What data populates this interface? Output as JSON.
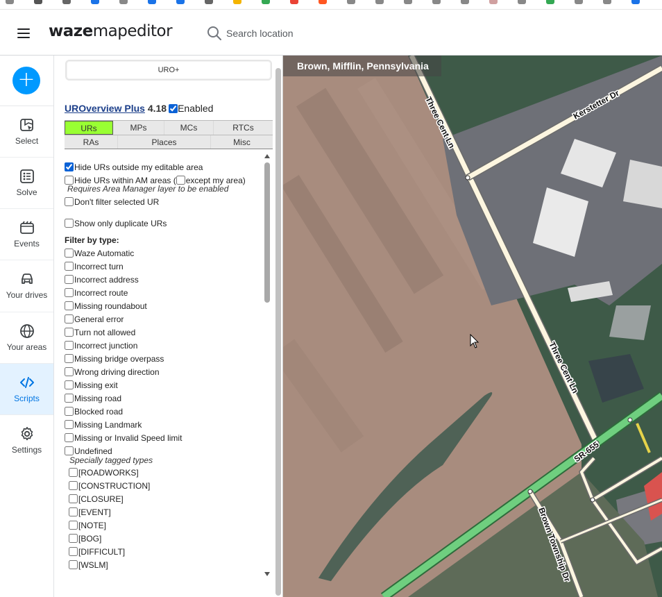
{
  "browser": {
    "bookmark_colors": [
      "#888888",
      "#555555",
      "#666666",
      "#1a73e8",
      "#888888",
      "#1a73e8",
      "#1a73e8",
      "#666666",
      "#f4b400",
      "#34a853",
      "#ea4335",
      "#ff5722",
      "#888888",
      "#888888",
      "#888888",
      "#888888",
      "#888888",
      "#d0a0a0",
      "#888888",
      "#34a853",
      "#888888",
      "#888888",
      "#1a73e8"
    ]
  },
  "header": {
    "logo_part1": "waze",
    "logo_part2": "mapeditor",
    "search_placeholder": "Search location"
  },
  "nav": {
    "items": [
      {
        "label": "Select",
        "icon": "select-icon"
      },
      {
        "label": "Solve",
        "icon": "solve-icon"
      },
      {
        "label": "Events",
        "icon": "events-icon"
      },
      {
        "label": "Your drives",
        "icon": "car-icon"
      },
      {
        "label": "Your areas",
        "icon": "globe-icon"
      },
      {
        "label": "Scripts",
        "icon": "code-icon",
        "active": true
      },
      {
        "label": "Settings",
        "icon": "gear-icon"
      }
    ]
  },
  "panel": {
    "uro_button": "URO+",
    "script_name": "UROverview Plus",
    "script_version": "4.18",
    "enabled_label": "Enabled",
    "enabled": true,
    "tabs_row1": [
      "URs",
      "MPs",
      "MCs",
      "RTCs"
    ],
    "tabs_row2": [
      "RAs",
      "Places",
      "Misc"
    ],
    "active_tab": "URs",
    "options": {
      "hide_outside": {
        "label": "Hide URs outside my editable area",
        "checked": true
      },
      "hide_within_am": {
        "label": "Hide URs within AM areas (",
        "checked": false
      },
      "except_my_area": {
        "label": "except my area)",
        "checked": false
      },
      "am_note": "Requires Area Manager layer to be enabled",
      "dont_filter_selected": {
        "label": "Don't filter selected UR",
        "checked": false
      },
      "show_only_duplicate": {
        "label": "Show only duplicate URs",
        "checked": false
      }
    },
    "filter_by_type_label": "Filter by type:",
    "types": [
      "Waze Automatic",
      "Incorrect turn",
      "Incorrect address",
      "Incorrect route",
      "Missing roundabout",
      "General error",
      "Turn not allowed",
      "Incorrect junction",
      "Missing bridge overpass",
      "Wrong driving direction",
      "Missing exit",
      "Missing road",
      "Blocked road",
      "Missing Landmark",
      "Missing or Invalid Speed limit",
      "Undefined"
    ],
    "specially_tagged_label": "Specially tagged types",
    "tagged_types": [
      "[ROADWORKS]",
      "[CONSTRUCTION]",
      "[CLOSURE]",
      "[EVENT]",
      "[NOTE]",
      "[BOG]",
      "[DIFFICULT]",
      "[WSLM]"
    ]
  },
  "map": {
    "location": "Brown, Mifflin, Pennsylvania",
    "roads": {
      "three_cent_upper": "Three Cent Ln",
      "three_cent_lower": "Three Cent Ln",
      "kerstetter": "Kerstetter Dr",
      "sr655": "SR-655",
      "brown_township": "Brown Township Dr"
    },
    "colors": {
      "field": "#a88c7e",
      "vegetation": "#3e5a48",
      "street": "#fdf6e0",
      "highway": "#6fcf7f",
      "parking": "#7d7f86"
    }
  }
}
